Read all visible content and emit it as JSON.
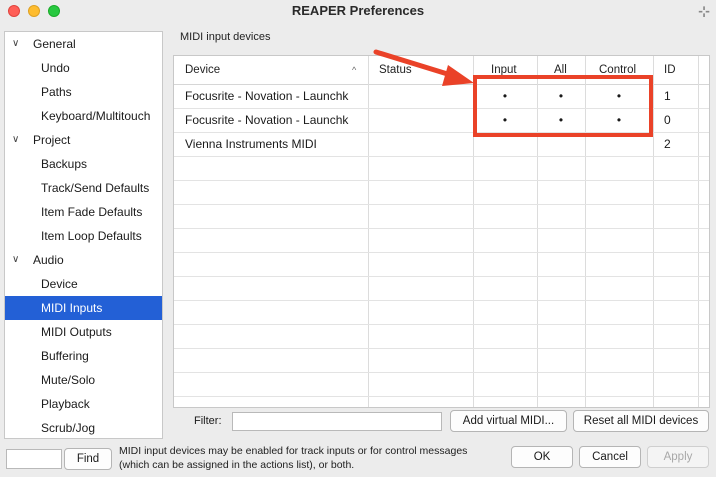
{
  "window": {
    "title": "REAPER Preferences"
  },
  "sidebar": {
    "items": [
      {
        "label": "General",
        "kind": "cat"
      },
      {
        "label": "Undo",
        "kind": "child"
      },
      {
        "label": "Paths",
        "kind": "child"
      },
      {
        "label": "Keyboard/Multitouch",
        "kind": "child"
      },
      {
        "label": "Project",
        "kind": "cat"
      },
      {
        "label": "Backups",
        "kind": "child"
      },
      {
        "label": "Track/Send Defaults",
        "kind": "child"
      },
      {
        "label": "Item Fade Defaults",
        "kind": "child"
      },
      {
        "label": "Item Loop Defaults",
        "kind": "child"
      },
      {
        "label": "Audio",
        "kind": "cat"
      },
      {
        "label": "Device",
        "kind": "child"
      },
      {
        "label": "MIDI Inputs",
        "kind": "child",
        "selected": true
      },
      {
        "label": "MIDI Outputs",
        "kind": "child"
      },
      {
        "label": "Buffering",
        "kind": "child"
      },
      {
        "label": "Mute/Solo",
        "kind": "child"
      },
      {
        "label": "Playback",
        "kind": "child"
      },
      {
        "label": "Scrub/Jog",
        "kind": "child"
      }
    ]
  },
  "panel": {
    "title": "MIDI input devices",
    "columns": [
      "Device",
      "Status",
      "Input",
      "All",
      "Control",
      "ID"
    ],
    "rows": [
      {
        "device": "Focusrite - Novation - Launchk",
        "status": "",
        "input": "•",
        "all": "•",
        "control": "•",
        "id": "1"
      },
      {
        "device": "Focusrite - Novation - Launchk",
        "status": "",
        "input": "•",
        "all": "•",
        "control": "•",
        "id": "0"
      },
      {
        "device": "Vienna Instruments MIDI",
        "status": "",
        "input": "",
        "all": "",
        "control": "",
        "id": "2"
      }
    ],
    "filter_label": "Filter:",
    "filter_value": "",
    "add_virtual_label": "Add virtual MIDI...",
    "reset_label": "Reset all MIDI devices"
  },
  "footer": {
    "find_label": "Find",
    "find_value": "",
    "help_text": "MIDI input devices may be enabled for track inputs or for control messages (which can be assigned in the actions list), or both.",
    "ok_label": "OK",
    "cancel_label": "Cancel",
    "apply_label": "Apply"
  },
  "colors": {
    "annotation": "#ea4228",
    "selection": "#2360d6"
  },
  "icons": {
    "sort": "chevron-up-icon",
    "pin": "pin-icon"
  }
}
